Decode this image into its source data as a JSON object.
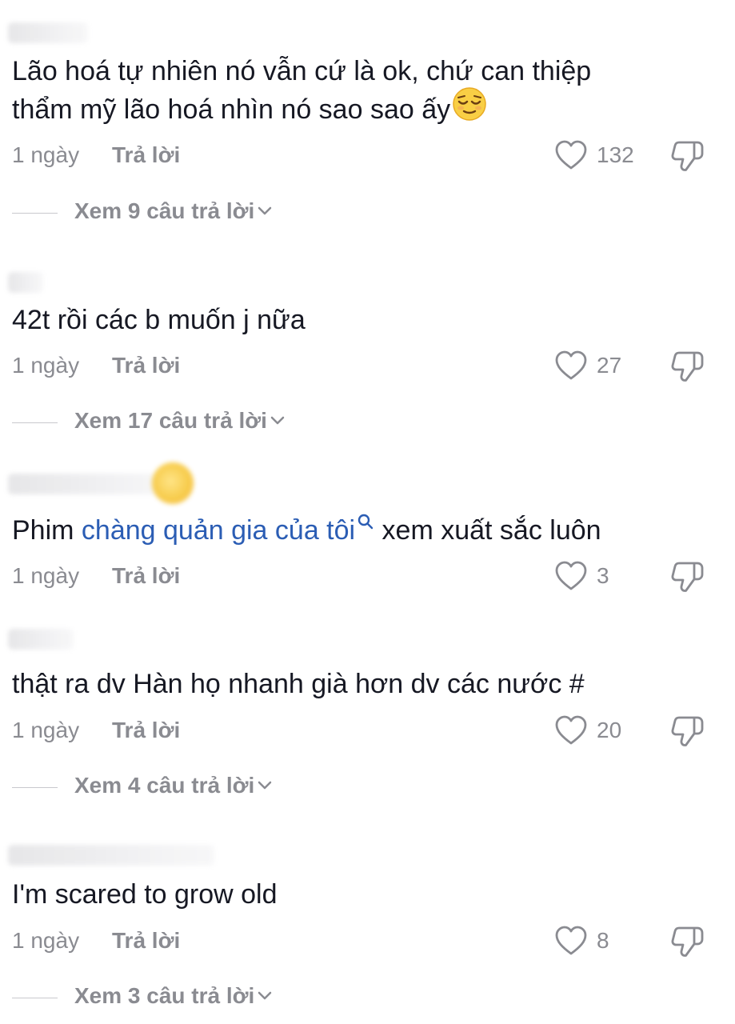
{
  "comments": [
    {
      "text_lines": [
        "Lão hoá tự nhiên nó vẫn cứ là ok, chứ can thiệp",
        "thẩm mỹ lão hoá nhìn nó sao sao ấy"
      ],
      "emoji": "relieved-face-emoji",
      "time": "1 ngày",
      "reply_label": "Trả lời",
      "likes": "132",
      "view_replies": "Xem 9 câu trả lời"
    },
    {
      "text": "42t rồi các b muốn j nữa",
      "time": "1 ngày",
      "reply_label": "Trả lời",
      "likes": "27",
      "view_replies": "Xem 17 câu trả lời"
    },
    {
      "text_before": "Phim ",
      "link_text": "chàng quản gia của tôi",
      "text_after": " xem xuất sắc luôn",
      "time": "1 ngày",
      "reply_label": "Trả lời",
      "likes": "3"
    },
    {
      "text": "thật ra dv Hàn họ nhanh già hơn dv các nước #",
      "time": "1 ngày",
      "reply_label": "Trả lời",
      "likes": "20",
      "view_replies": "Xem 4 câu trả lời"
    },
    {
      "text": "I'm scared to grow old",
      "time": "1 ngày",
      "reply_label": "Trả lời",
      "likes": "8",
      "view_replies": "Xem 3 câu trả lời"
    }
  ],
  "colors": {
    "text": "#161823",
    "meta": "#8a8b91",
    "link": "#2b5db4",
    "divider": "#c9c9cd"
  },
  "icons": [
    "heart-icon",
    "dislike-icon",
    "chevron-down-icon",
    "search-icon"
  ]
}
